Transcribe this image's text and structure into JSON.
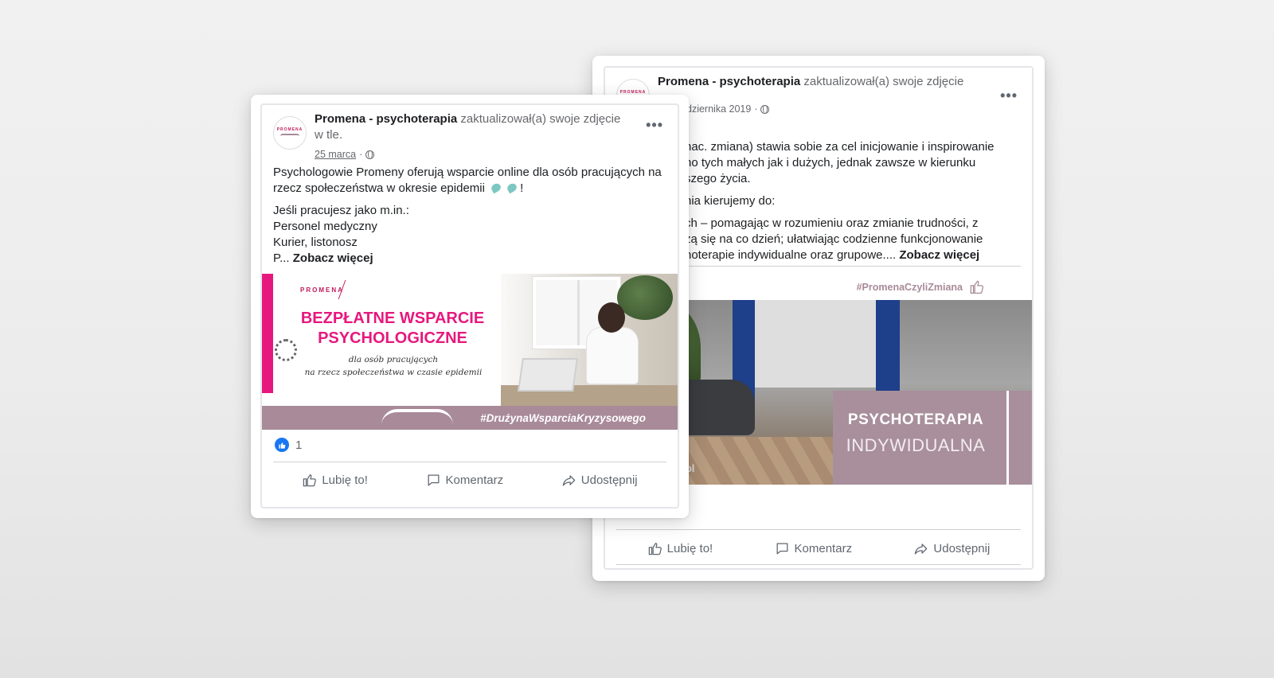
{
  "back_post": {
    "page_name": "Promena - psychoterapia",
    "action": "zaktualizował(a) swoje zdjęcie",
    "date": "dziernika 2019",
    "more": "•••",
    "paragraphs": [
      "nac. zmiana) stawia sobie za cel inicjowanie i inspirowanie",
      "no tych małych jak i dużych, jednak zawsze w kierunku",
      "szego życia.",
      "nia kierujemy do:",
      "ch – pomagając w rozumieniu oraz zmianie trudności, z",
      "zą się na co dzień; ułatwiając codzienne funkcjonowanie",
      "hoterapie indywidualne oraz grupowe...."
    ],
    "see_more": "Zobacz więcej",
    "hashtag": "#PromenaCzyliZmiana",
    "image": {
      "title": "PSYCHOTERAPIA",
      "subtitle": "INDYWIDUALNA",
      "url_fragment": "a.pl"
    },
    "actions": {
      "like": "Lubię to!",
      "comment": "Komentarz",
      "share": "Udostępnij"
    }
  },
  "front_post": {
    "page_name": "Promena - psychoterapia",
    "action": "zaktualizował(a) swoje zdjęcie w tle.",
    "date": "25 marca",
    "more": "•••",
    "paragraph1": "Psychologowie Promeny oferują wsparcie online dla osób pracujących na rzecz społeczeństwa w okresie epidemii",
    "paragraph1_end": "!",
    "line1": "Jeśli pracujesz jako m.in.:",
    "line2": "Personel medyczny",
    "line3": "Kurier, listonosz",
    "line4": "P...",
    "see_more": "Zobacz więcej",
    "image": {
      "logo": "PROMENA",
      "title_line1": "BEZPŁATNE WSPARCIE",
      "title_line2": "PSYCHOLOGICZNE",
      "subtitle_line1": "dla osób pracujących",
      "subtitle_line2": "na rzecz społeczeństwa w czasie epidemii",
      "hashtag": "#DrużynaWsparciaKryzysowego"
    },
    "like_count": "1",
    "actions": {
      "like": "Lubię to!",
      "comment": "Komentarz",
      "share": "Udostępnij"
    }
  },
  "colors": {
    "brand_pink": "#e6187e",
    "brand_mauve": "#a88a98",
    "fb_blue": "#1877f2"
  }
}
